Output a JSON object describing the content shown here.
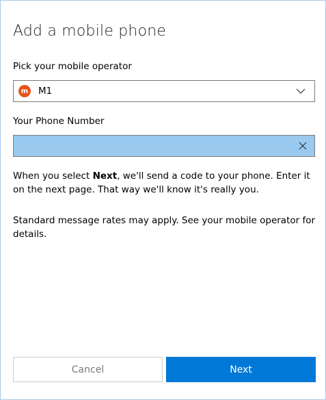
{
  "dialog": {
    "title": "Add a mobile phone"
  },
  "operator": {
    "label": "Pick your mobile operator",
    "selected": "M1",
    "logo_text": "m",
    "logo_color": "#e8541a",
    "chevron_icon": "chevron-down-icon"
  },
  "phone": {
    "label": "Your Phone Number",
    "value": "",
    "clear_icon": "close-icon"
  },
  "info": {
    "para1_pre": "When you select ",
    "para1_bold": "Next",
    "para1_post": ", we'll send a code to your phone. Enter it on the next page. That way we'll know it's really you.",
    "para2": "Standard message rates may apply. See your mobile operator for details."
  },
  "buttons": {
    "cancel": "Cancel",
    "next": "Next"
  },
  "colors": {
    "accent": "#0078d7",
    "input_highlight": "#99c9ef"
  }
}
